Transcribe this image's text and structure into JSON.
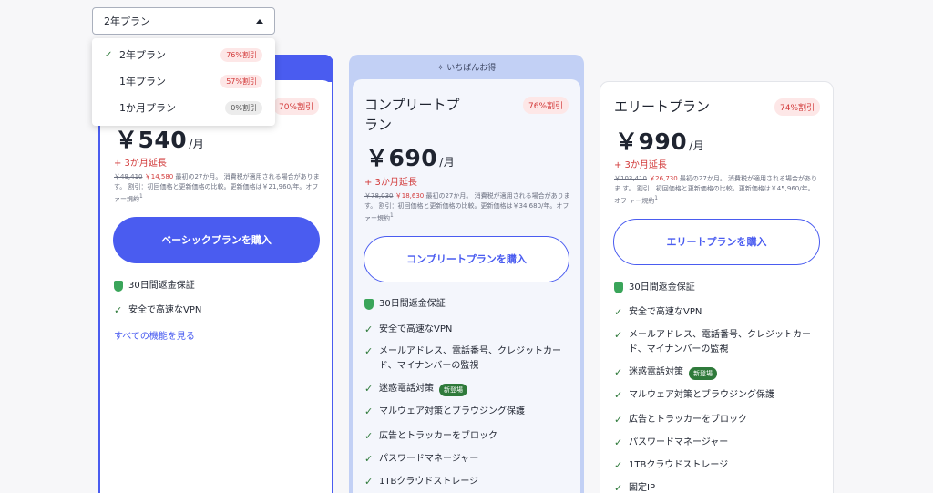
{
  "plan_select": {
    "value": "2年プラン"
  },
  "dropdown": {
    "options": [
      {
        "label": "2年プラン",
        "discount": "76%割引",
        "selected": true
      },
      {
        "label": "1年プラン",
        "discount": "57%割引",
        "selected": false
      },
      {
        "label": "1か月プラン",
        "discount": "0%割引",
        "selected": false
      }
    ]
  },
  "basic": {
    "discount": "70%割引",
    "price": "￥540",
    "per": "/月",
    "extend": "+ 3か月延長",
    "old_price": "￥49,410",
    "new_price": "￥14,580",
    "fine_rest": " 最初の27か月。 消費税が適用される場合がありま す。 割引：初回価格と更新価格の比較。更新価格は￥21,960/年。オフ ァー規約",
    "fine_sup": "1",
    "button": "ベーシックプランを購入",
    "guarantee": "30日間返金保証",
    "features": [
      "安全で高速なVPN"
    ],
    "all_features_link": "すべての機能を見る"
  },
  "complete": {
    "ribbon": "いちばんお得",
    "title": "コンプリートプラン",
    "discount": "76%割引",
    "price": "￥690",
    "per": "/月",
    "extend": "+ 3か月延長",
    "old_price": "￥78,030",
    "new_price": "￥18,630",
    "fine_rest": " 最初の27か月。 消費税が適用される場合がありま す。 割引：初回価格と更新価格の比較。更新価格は￥34,680/年。オフ ァー規約",
    "fine_sup": "1",
    "button": "コンプリートプランを購入",
    "guarantee": "30日間返金保証",
    "features": [
      "安全で高速なVPN",
      "メールアドレス、電話番号、クレジットカード、マイナンバーの監視",
      "迷惑電話対策",
      "マルウェア対策とブラウジング保護",
      "広告とトラッカーをブロック",
      "パスワードマネージャー",
      "1TBクラウドストレージ"
    ],
    "new_badge": "新登場"
  },
  "elite": {
    "title": "エリートプラン",
    "discount": "74%割引",
    "price": "￥990",
    "per": "/月",
    "extend": "+ 3か月延長",
    "old_price": "￥103,410",
    "new_price": "￥26,730",
    "fine_rest": " 最初の27か月。 消費税が適用される場合がありま す。 割引：初回価格と更新価格の比較。更新価格は￥45,960/年。オフ ァー規約",
    "fine_sup": "1",
    "button": "エリートプランを購入",
    "guarantee": "30日間返金保証",
    "features": [
      "安全で高速なVPN",
      "メールアドレス、電話番号、クレジットカード、マイナンバーの監視",
      "迷惑電話対策",
      "マルウェア対策とブラウジング保護",
      "広告とトラッカーをブロック",
      "パスワードマネージャー",
      "1TBクラウドストレージ",
      "固定IP"
    ],
    "new_badge": "新登場"
  },
  "colors": {
    "accent": "#4a5cf0",
    "discount_red": "#d23a3a",
    "check_green": "#2f7a3b"
  }
}
